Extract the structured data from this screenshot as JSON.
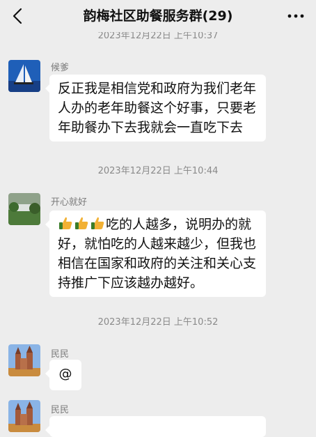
{
  "header": {
    "title": "韵梅社区助餐服务群(29)"
  },
  "top_partial_timestamp": "2023年12月22日 上午10:37",
  "messages": [
    {
      "sender": "候爹",
      "text": "反正我是相信党和政府为我们老年人办的老年助餐这个好事，只要老年助餐办下去我就会一直吃下去"
    },
    {
      "sender": "开心就好",
      "emoji": [
        "thumbs-up-emoji",
        "thumbs-up-emoji",
        "thumbs-up-emoji"
      ],
      "text": "吃的人越多，说明办的就好，就怕吃的人越来越少，但我也相信在国家和政府的关注和关心支持推广下应该越办越好。"
    },
    {
      "sender": "民民",
      "text": "@"
    },
    {
      "sender": "民民"
    }
  ],
  "timestamps": [
    "2023年12月22日 上午10:44",
    "2023年12月22日 上午10:52"
  ]
}
